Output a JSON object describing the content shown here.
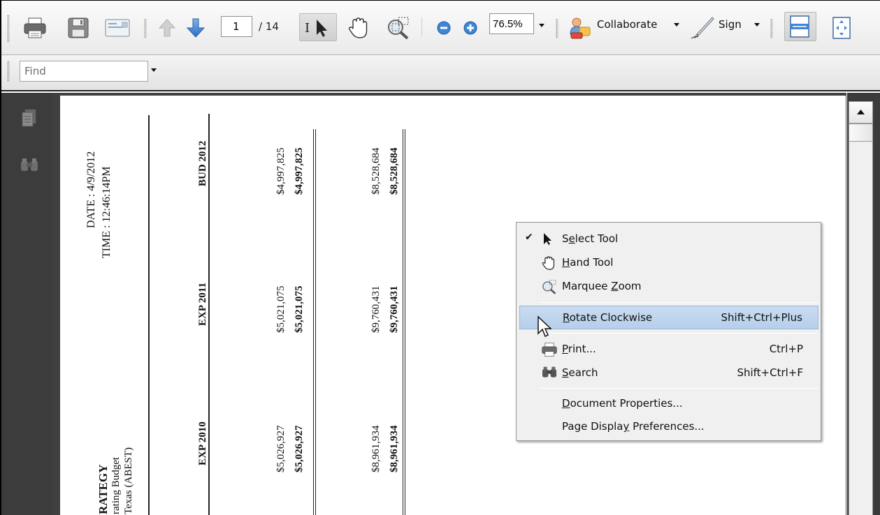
{
  "toolbar": {
    "page_current": "1",
    "page_total": "/ 14",
    "zoom": "76.5%",
    "collaborate_label": "Collaborate",
    "sign_label": "Sign",
    "icons": [
      "print-icon",
      "save-icon",
      "email-icon",
      "previous-page-icon",
      "next-page-icon",
      "select-tool-icon",
      "hand-tool-icon",
      "marquee-zoom-icon",
      "zoom-out-icon",
      "zoom-in-icon",
      "collaborate-icon",
      "sign-pen-icon",
      "fit-width-icon",
      "fit-page-icon"
    ]
  },
  "find": {
    "placeholder": "Find"
  },
  "document": {
    "date_line": "DATE :   4/9/2012",
    "time_line": "TIME  :  12:46:14PM",
    "strategy_line1": "RATEGY",
    "strategy_line2": "rating Budget",
    "strategy_line3": "Texas (ABEST)",
    "columns": [
      {
        "header": "EXP 2010",
        "v1": "$5,026,927",
        "v1b": "$5,026,927",
        "v2": "$8,961,934",
        "v2b": "$8,961,934"
      },
      {
        "header": "EXP 2011",
        "v1": "$5,021,075",
        "v1b": "$5,021,075",
        "v2": "$9,760,431",
        "v2b": "$9,760,431"
      },
      {
        "header": "BUD 2012",
        "v1": "$4,997,825",
        "v1b": "$4,997,825",
        "v2": "$8,528,684",
        "v2b": "$8,528,684"
      }
    ]
  },
  "context_menu": {
    "items": [
      {
        "label_pre": "S",
        "label_u": "e",
        "label_post": "lect Tool",
        "shortcut": "",
        "checked": true,
        "icon": "select-arrow-icon"
      },
      {
        "label_pre": "",
        "label_u": "H",
        "label_post": "and Tool",
        "shortcut": "",
        "checked": false,
        "icon": "hand-icon"
      },
      {
        "label_pre": "Marquee ",
        "label_u": "Z",
        "label_post": "oom",
        "shortcut": "",
        "checked": false,
        "icon": "marquee-zoom-icon"
      },
      {
        "label_pre": "",
        "label_u": "R",
        "label_post": "otate Clockwise",
        "shortcut": "Shift+Ctrl+Plus",
        "checked": false,
        "icon": ""
      },
      {
        "label_pre": "",
        "label_u": "P",
        "label_post": "rint...",
        "shortcut": "Ctrl+P",
        "checked": false,
        "icon": "printer-icon"
      },
      {
        "label_pre": "",
        "label_u": "S",
        "label_post": "earch",
        "shortcut": "Shift+Ctrl+F",
        "checked": false,
        "icon": "binoculars-icon"
      },
      {
        "label_pre": "",
        "label_u": "D",
        "label_post": "ocument Properties...",
        "shortcut": "",
        "checked": false,
        "icon": ""
      },
      {
        "label_pre": "Page Displa",
        "label_u": "y",
        "label_post": " Preferences...",
        "shortcut": "",
        "checked": false,
        "icon": ""
      }
    ],
    "check_mark": "✔"
  },
  "colors": {
    "highlight": "#b6cfea",
    "nav_pane": "#3c3c3c",
    "accent_blue": "#3a7bd5"
  }
}
